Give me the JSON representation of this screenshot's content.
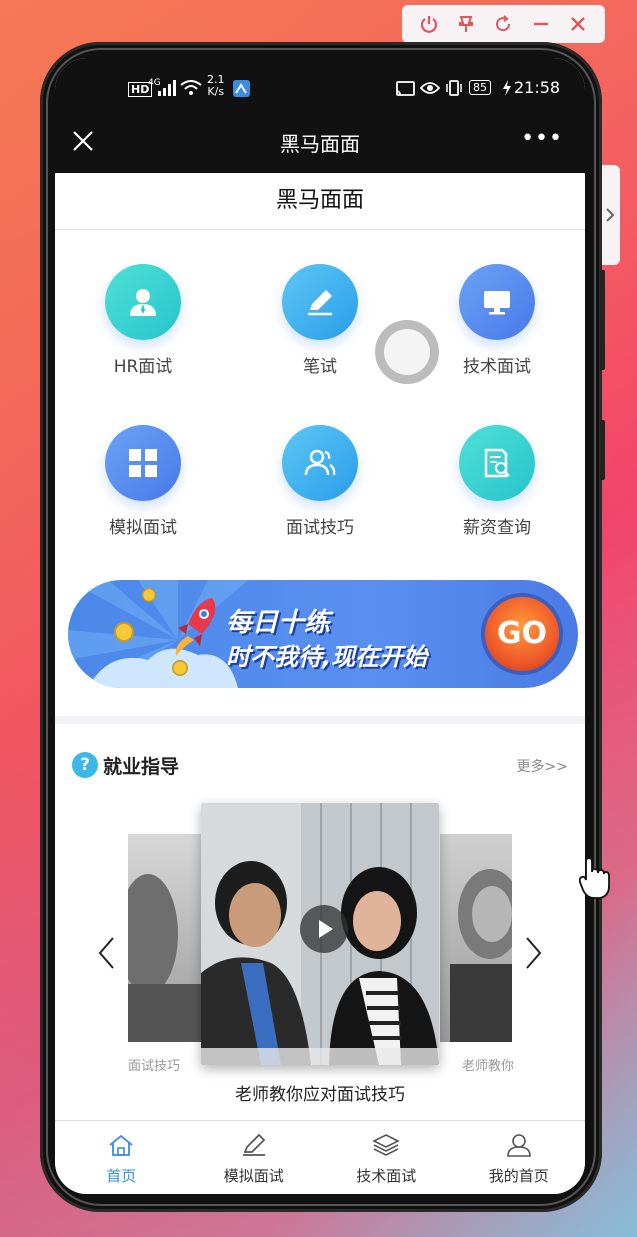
{
  "status_bar": {
    "net_speed_top": "2.1",
    "net_speed_unit": "K/s",
    "battery": "85",
    "time": "21:58",
    "network": "4G"
  },
  "titlebar": {
    "title": "黑马面面",
    "more": "•••"
  },
  "page_header": "黑马面面",
  "grid": [
    {
      "label": "HR面试",
      "icon": "person-icon"
    },
    {
      "label": "笔试",
      "icon": "pencil-icon"
    },
    {
      "label": "技术面试",
      "icon": "monitor-icon"
    },
    {
      "label": "模拟面试",
      "icon": "grid-icon"
    },
    {
      "label": "面试技巧",
      "icon": "users-icon"
    },
    {
      "label": "薪资查询",
      "icon": "document-search-icon"
    }
  ],
  "banner": {
    "line1": "每日十练",
    "line2": "时不我待,现在开始",
    "go": "GO"
  },
  "section": {
    "title": "就业指导",
    "icon": "?",
    "more": "更多>>"
  },
  "carousel": {
    "main_caption": "老师教你应对面试技巧",
    "left_caption": "面试技巧",
    "right_caption": "老师教你"
  },
  "tabs": [
    {
      "label": "首页",
      "icon": "home-icon",
      "active": true
    },
    {
      "label": "模拟面试",
      "icon": "edit-icon",
      "active": false
    },
    {
      "label": "技术面试",
      "icon": "layers-icon",
      "active": false
    },
    {
      "label": "我的首页",
      "icon": "user-icon",
      "active": false
    }
  ]
}
